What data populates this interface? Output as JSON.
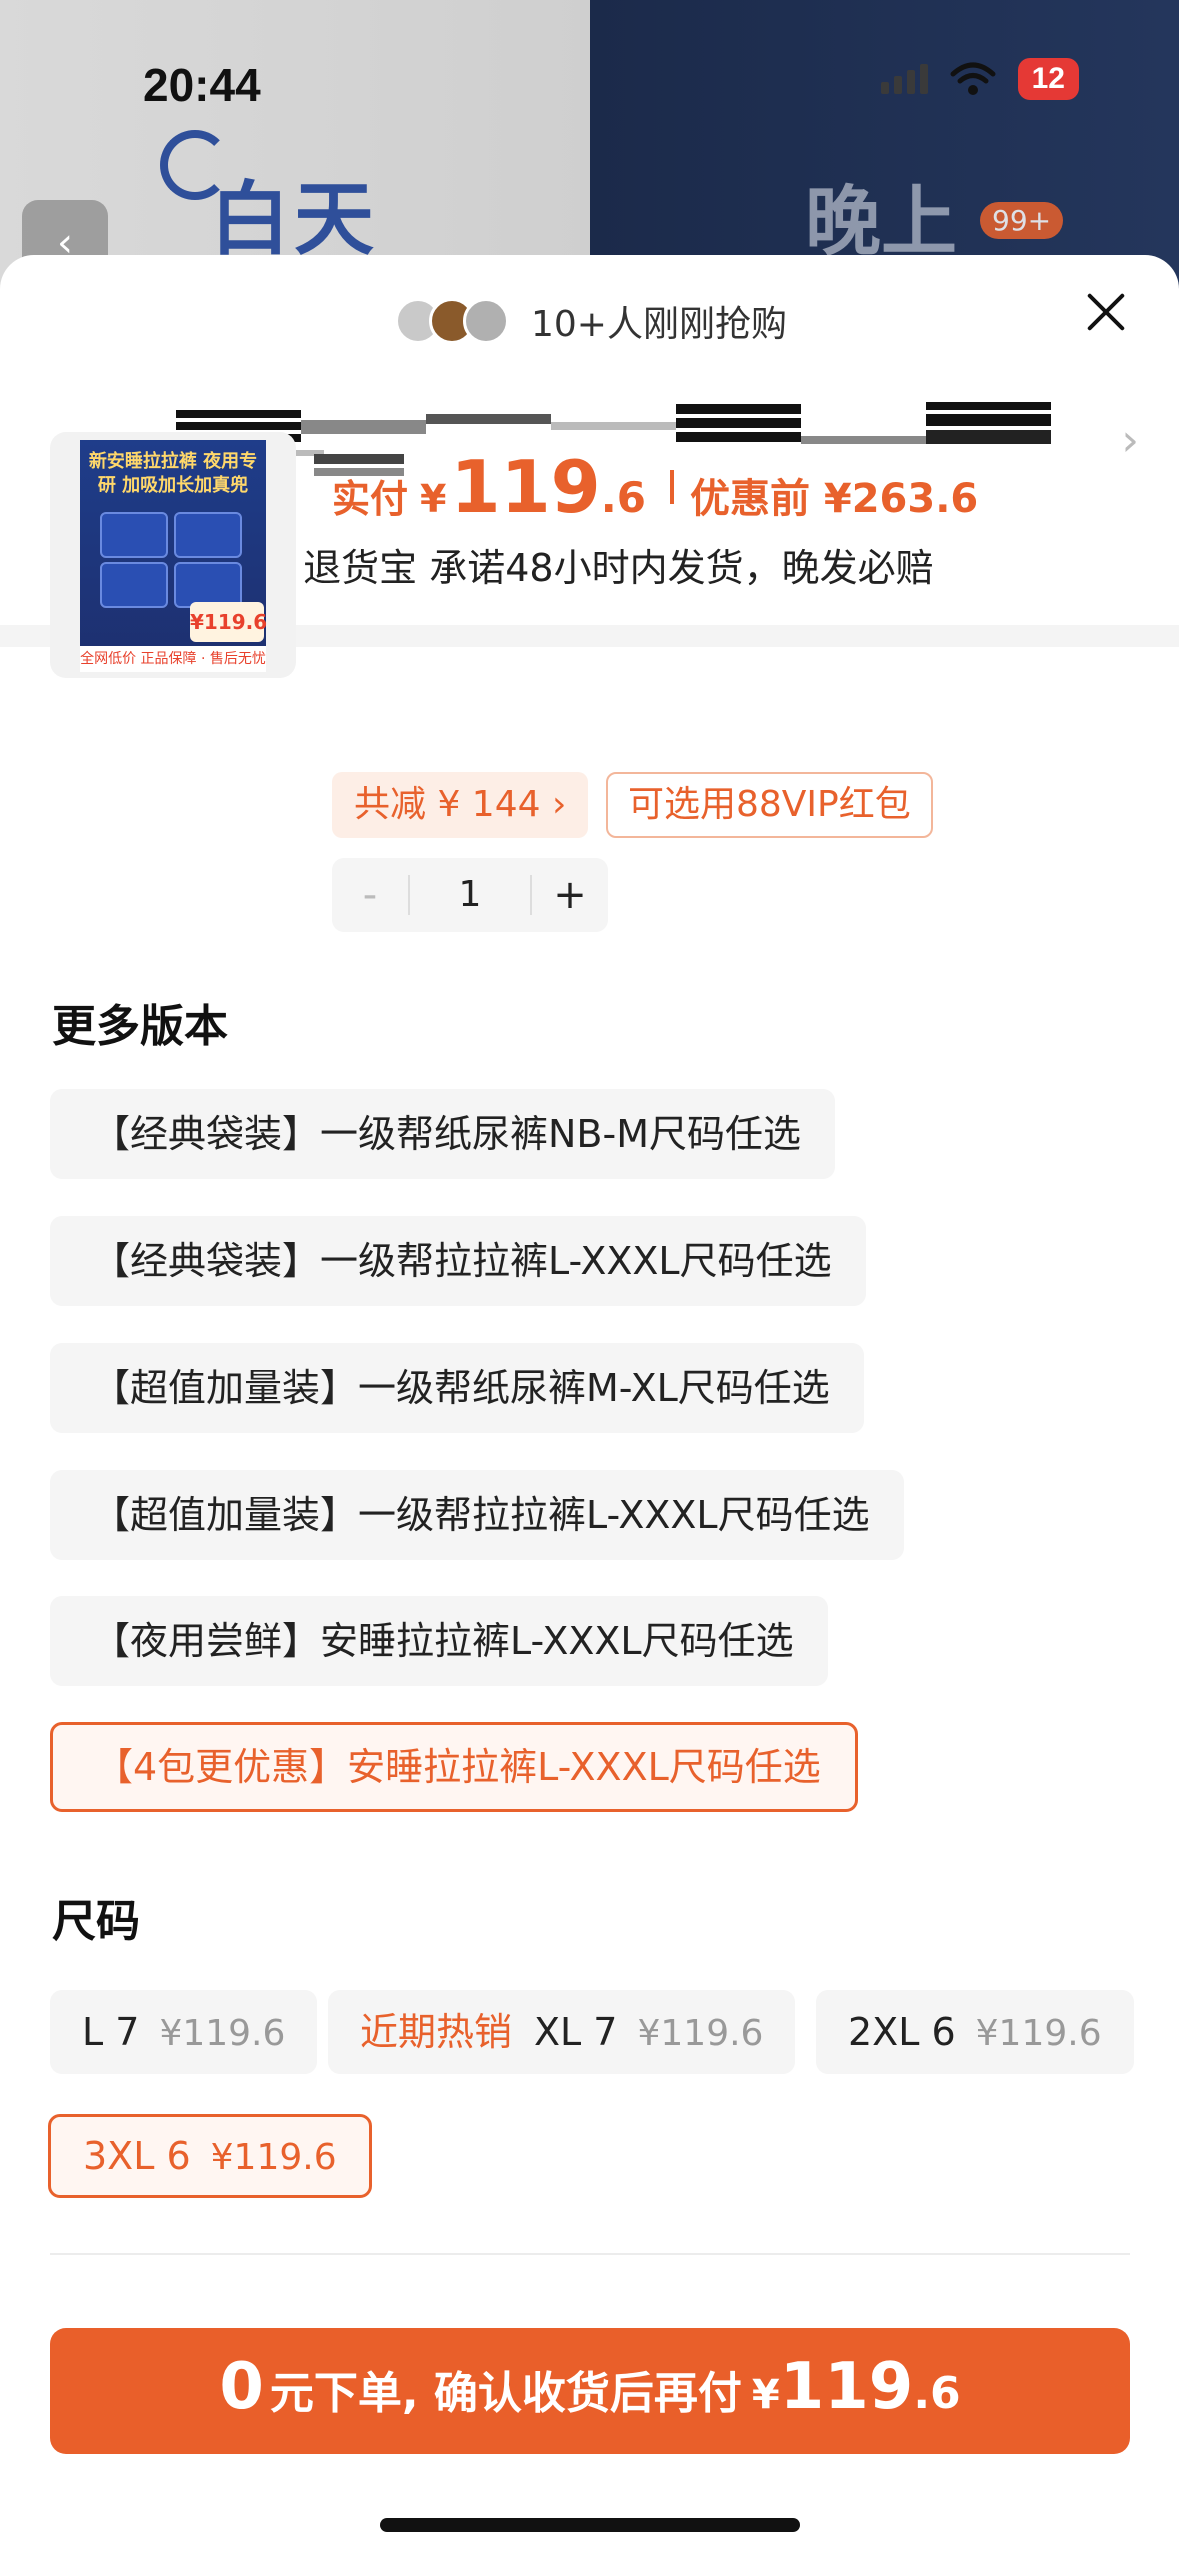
{
  "status_bar": {
    "time": "20:44",
    "battery": "12"
  },
  "background": {
    "left_text": "白天",
    "right_text": "晚上",
    "cart_badge": "99+"
  },
  "sheet": {
    "buyers_text": "10+人刚刚抢购",
    "shipping_info": "快递 包邮 退货宝 承诺48小时内发货，晚发必赔"
  },
  "product": {
    "thumb_title": "新安睡拉拉裤 夜用专研 加吸加长加真兜",
    "thumb_price": "¥119.6",
    "thumb_footer": "全网低价  正品保障 · 售后无忧",
    "price_label": "实付",
    "price_yen": "¥",
    "price_int": "119",
    "price_dec": ".6",
    "orig_price": "优惠前 ¥263.6",
    "save_chip": "共减 ¥ 144 ›",
    "vip_chip": "可选用88VIP红包",
    "quantity": "1",
    "minus": "-",
    "plus": "+"
  },
  "versions": {
    "title": "更多版本",
    "items": [
      {
        "label": "【经典袋装】一级帮纸尿裤NB-M尺码任选"
      },
      {
        "label": "【经典袋装】一级帮拉拉裤L-XXXL尺码任选"
      },
      {
        "label": "【超值加量装】一级帮纸尿裤M-XL尺码任选"
      },
      {
        "label": "【超值加量装】一级帮拉拉裤L-XXXL尺码任选"
      },
      {
        "label": "【夜用尝鲜】安睡拉拉裤L-XXXL尺码任选"
      },
      {
        "label": "【4包更优惠】安睡拉拉裤L-XXXL尺码任选",
        "selected": true
      }
    ]
  },
  "sizes": {
    "title": "尺码",
    "items": [
      {
        "label": "L 7",
        "price": "¥119.6"
      },
      {
        "hot": "近期热销",
        "label": "XL 7",
        "price": "¥119.6"
      },
      {
        "label": "2XL 6",
        "price": "¥119.6"
      },
      {
        "label": "3XL 6",
        "price": "¥119.6",
        "selected": true
      }
    ]
  },
  "cta": {
    "zero": "0",
    "middle": "元下单, 确认收货后再付",
    "yen": "¥",
    "int": "119",
    "dec": ".6"
  },
  "colors": {
    "accent": "#e95f2a",
    "chip_bg": "#f5f5f5"
  }
}
